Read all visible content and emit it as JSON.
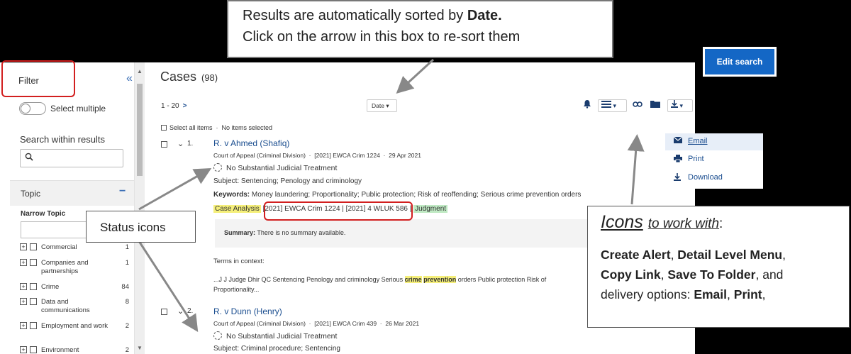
{
  "callout_top": {
    "line1_prefix": "Results are automatically sorted by ",
    "line1_bold": "Date.",
    "line2": "Click on the arrow in this box to re-sort them"
  },
  "edit_search": {
    "label": "Edit search",
    "color": "#1467c5"
  },
  "sidebar": {
    "filter_label": "Filter",
    "collapse_icon": "«",
    "select_multiple": "Select multiple",
    "search_within_label": "Search within results",
    "topic_label": "Topic",
    "topic_collapse": "−",
    "narrow_topic_label": "Narrow Topic",
    "topics": [
      {
        "name": "Commercial",
        "count": "1"
      },
      {
        "name": "Companies and partnerships",
        "count": "1"
      },
      {
        "name": "Crime",
        "count": "84"
      },
      {
        "name": "Data and communications",
        "count": "8"
      },
      {
        "name": "Employment and work",
        "count": "2"
      },
      {
        "name": "Environment",
        "count": "2"
      }
    ]
  },
  "results_header": {
    "title": "Cases",
    "count": "(98)",
    "paging": "1 - 20",
    "next": ">",
    "sort": "Date",
    "select_all": "Select all items",
    "no_selected": "No items selected"
  },
  "results": [
    {
      "index": "1.",
      "title": "R. v Ahmed (Shafiq)",
      "court": "Court of Appeal (Criminal Division)",
      "citation": "[2021] EWCA Crim 1224",
      "date": "29 Apr 2021",
      "status": "No Substantial Judicial Treatment",
      "subject_label": "Subject:",
      "subject": "Sentencing; Penology and criminology",
      "keywords_label": "Keywords:",
      "keywords": "Money laundering; Proportionality; Public protection; Risk of reoffending; Serious crime prevention orders",
      "case_analysis": "Case Analysis",
      "citations": "[2021] EWCA Crim 1224 | [2021] 4 WLUK 586",
      "judgment": "Judgment",
      "summary_label": "Summary:",
      "summary": "There is no summary available.",
      "terms_label": "Terms in context:",
      "terms_pre": "...J J Judge Dhir QC Sentencing Penology and criminology Serious ",
      "terms_hl1": "crime",
      "terms_hl2": "prevention",
      "terms_post": " orders Public protection Risk of",
      "terms_line2": "Proportionality..."
    },
    {
      "index": "2.",
      "title": "R. v Dunn (Henry)",
      "court": "Court of Appeal (Criminal Division)",
      "citation": "[2021] EWCA Crim 439",
      "date": "26 Mar 2021",
      "status": "No Substantial Judicial Treatment",
      "subject_label": "Subject:",
      "subject": "Criminal procedure; Sentencing"
    }
  ],
  "delivery_menu": {
    "email": "Email",
    "print": "Print",
    "download": "Download"
  },
  "status_callout": "Status icons",
  "icons_callout": {
    "icons_word": "Icons",
    "to_work_with": "to work with",
    "colon": ":",
    "create_alert": "Create Alert",
    "detail_level": "Detail Level Menu",
    "copy_link": "Copy Link",
    "save_folder": "Save To Folder",
    "and": "and",
    "delivery_options": "delivery options: ",
    "email": "Email",
    "print": "Print"
  },
  "icons": {
    "bell": "bell-icon",
    "detail": "list-icon",
    "link": "link-icon",
    "folder": "folder-icon",
    "download": "download-icon"
  }
}
